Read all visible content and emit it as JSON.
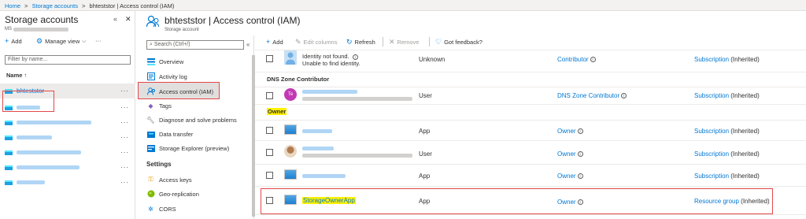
{
  "breadcrumb": {
    "items": [
      "Home",
      ">",
      "Storage accounts",
      ">",
      "bhteststor | Access control (IAM)"
    ]
  },
  "left_blade": {
    "title": "Storage accounts",
    "subtitle": "MS",
    "toolbar": {
      "add": "Add",
      "manage_view": "Manage view",
      "more": "···"
    },
    "filter_placeholder": "Filter by name...",
    "name_header": "Name ↑",
    "items": [
      {
        "label": "bhteststor",
        "dots": "···"
      },
      {
        "label": "",
        "dots": "···"
      },
      {
        "label": "",
        "dots": "···"
      },
      {
        "label": "",
        "dots": "···"
      },
      {
        "label": "",
        "dots": "···"
      },
      {
        "label": "",
        "dots": "···"
      },
      {
        "label": "",
        "dots": "···"
      }
    ],
    "collapse_icon": "«",
    "close_icon": "✕"
  },
  "menu_blade": {
    "resource_title": "bhteststor | Access control (IAM)",
    "resource_subtitle": "Storage account",
    "search_placeholder": "Search (Ctrl+/)",
    "collapse_icon": "«",
    "items": [
      {
        "label": "Overview",
        "icon": "overview-icon"
      },
      {
        "label": "Activity log",
        "icon": "activity-log-icon"
      },
      {
        "label": "Access control (IAM)",
        "icon": "iam-icon"
      },
      {
        "label": "Tags",
        "icon": "tag-icon"
      },
      {
        "label": "Diagnose and solve problems",
        "icon": "wrench-icon"
      },
      {
        "label": "Data transfer",
        "icon": "data-transfer-icon"
      },
      {
        "label": "Storage Explorer (preview)",
        "icon": "storage-explorer-icon"
      }
    ],
    "settings_header": "Settings",
    "settings_items": [
      {
        "label": "Access keys",
        "icon": "key-icon"
      },
      {
        "label": "Geo-replication",
        "icon": "globe-icon"
      },
      {
        "label": "CORS",
        "icon": "cors-icon"
      }
    ]
  },
  "main": {
    "toolbar": {
      "add": "Add",
      "edit_columns": "Edit columns",
      "refresh": "Refresh",
      "remove": "Remove",
      "feedback": "Got feedback?"
    },
    "rows": [
      {
        "name_line1": "Identity not found.",
        "name_line2": "Unable to find identity.",
        "type": "Unknown",
        "role": "Contributor",
        "scope_link": "Subscription",
        "scope_suffix": "(Inherited)"
      }
    ],
    "group_dns": "DNS Zone Contributor",
    "dns_row": {
      "type": "User",
      "role": "DNS Zone Contributor",
      "scope_link": "Subscription",
      "scope_suffix": "(Inherited)",
      "avatar_letter": "Te"
    },
    "group_owner": "Owner",
    "owner_rows": [
      {
        "type": "App",
        "role": "Owner",
        "scope_link": "Subscription",
        "scope_suffix": "(Inherited)"
      },
      {
        "type": "User",
        "role": "Owner",
        "scope_link": "Subscription",
        "scope_suffix": "(Inherited)"
      },
      {
        "type": "App",
        "role": "Owner",
        "scope_link": "Subscription",
        "scope_suffix": "(Inherited)"
      },
      {
        "name": "StorageOwnerApp",
        "type": "App",
        "role": "Owner",
        "scope_link": "Resource group",
        "scope_suffix": "(Inherited)"
      }
    ],
    "info_glyph": "i"
  }
}
